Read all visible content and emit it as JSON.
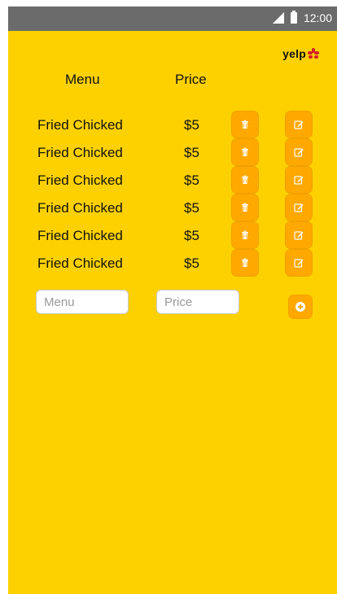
{
  "status_bar": {
    "time": "12:00",
    "signal_icon": "signal-icon",
    "battery_icon": "battery-icon"
  },
  "logo": {
    "text": "yelp"
  },
  "headers": {
    "menu": "Menu",
    "price": "Price"
  },
  "items": [
    {
      "name": "Fried Chicked",
      "price": "$5"
    },
    {
      "name": "Fried Chicked",
      "price": "$5"
    },
    {
      "name": "Fried Chicked",
      "price": "$5"
    },
    {
      "name": "Fried Chicked",
      "price": "$5"
    },
    {
      "name": "Fried Chicked",
      "price": "$5"
    },
    {
      "name": "Fried Chicked",
      "price": "$5"
    }
  ],
  "form": {
    "menu_placeholder": "Menu",
    "price_placeholder": "Price"
  },
  "colors": {
    "background": "#FDD100",
    "button": "#FFA800",
    "status_bar": "#6b6b6b"
  },
  "icons": {
    "delete": "trash-icon",
    "edit": "edit-icon",
    "add": "plus-circle-icon"
  }
}
